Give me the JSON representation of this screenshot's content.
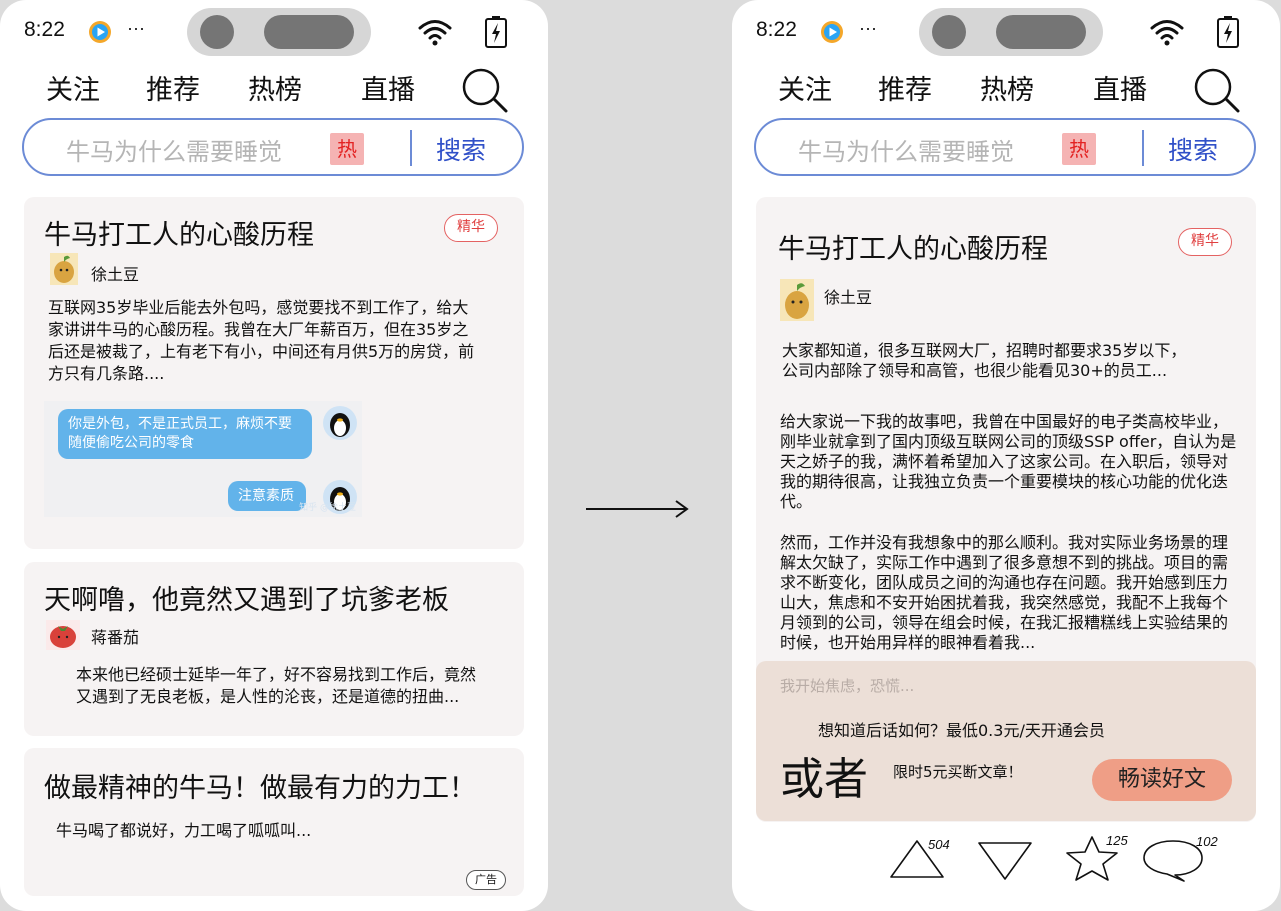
{
  "status": {
    "time": "8:22",
    "more": "···"
  },
  "nav": {
    "tabs": [
      "关注",
      "推荐",
      "热榜",
      "直播"
    ]
  },
  "search": {
    "placeholder": "牛马为什么需要睡觉",
    "hot": "热",
    "button": "搜索"
  },
  "left": {
    "card1": {
      "title": "牛马打工人的心酸历程",
      "badge": "精华",
      "author": "徐土豆",
      "excerpt": "互联网35岁毕业后能去外包吗，感觉要找不到工作了，给大家讲讲牛马的心酸历程。我曾在大厂年薪百万，但在35岁之后还是被裁了，上有老下有小，中间还有月供5万的房贷，前方只有几条路....",
      "chat": {
        "bubble1": "你是外包，不是正式员工，麻烦不要随便偷吃公司的零食",
        "bubble2": "注意素质",
        "watermark": "知乎 @徐土豆"
      }
    },
    "card2": {
      "title": "天啊噜，他竟然又遇到了坑爹老板",
      "author": "蒋番茄",
      "excerpt": "本来他已经硕士延毕一年了，好不容易找到工作后，竟然又遇到了无良老板，是人性的沦丧，还是道德的扭曲..."
    },
    "card3": {
      "title": "做最精神的牛马！做最有力的力工！",
      "excerpt": "牛马喝了都说好，力工喝了呱呱叫...",
      "ad": "广告"
    }
  },
  "right": {
    "article": {
      "title": "牛马打工人的心酸历程",
      "badge": "精华",
      "author": "徐土豆",
      "para1": "大家都知道，很多互联网大厂，招聘时都要求35岁以下，公司内部除了领导和高管，也很少能看见30+的员工...",
      "para2": "给大家说一下我的故事吧，我曾在中国最好的电子类高校毕业，刚毕业就拿到了国内顶级互联网公司的顶级SSP offer，自认为是天之娇子的我，满怀着希望加入了这家公司。在入职后，领导对我的期待很高，让我独立负责一个重要模块的核心功能的优化迭代。",
      "para3": "然而，工作并没有我想象中的那么顺利。我对实际业务场景的理解太欠缺了，实际工作中遇到了很多意想不到的挑战。项目的需求不断变化，团队成员之间的沟通也存在问题。我开始感到压力山大，焦虑和不安开始困扰着我，我突然感觉，我配不上我每个月领到的公司，领导在组会时候，在我汇报糟糕线上实验结果的时候，也开始用异样的眼神看着我..."
    },
    "paywall": {
      "faded": "我开始焦虑，恐慌...",
      "offer": "想知道后话如何？最低0.3元/天开通会员",
      "or": "或者",
      "buyout": "限时5元买断文章！",
      "button": "畅读好文"
    },
    "actions": {
      "upvotes": "504",
      "stars": "125",
      "comments": "102"
    }
  },
  "colors": {
    "accent_blue": "#3050c8",
    "hot_red": "#e32222",
    "card_bg": "#f6f3f3",
    "paywall_bg": "#ecdfd7",
    "read_button": "#ef9e86",
    "chat_bubble": "#62b3ea"
  }
}
